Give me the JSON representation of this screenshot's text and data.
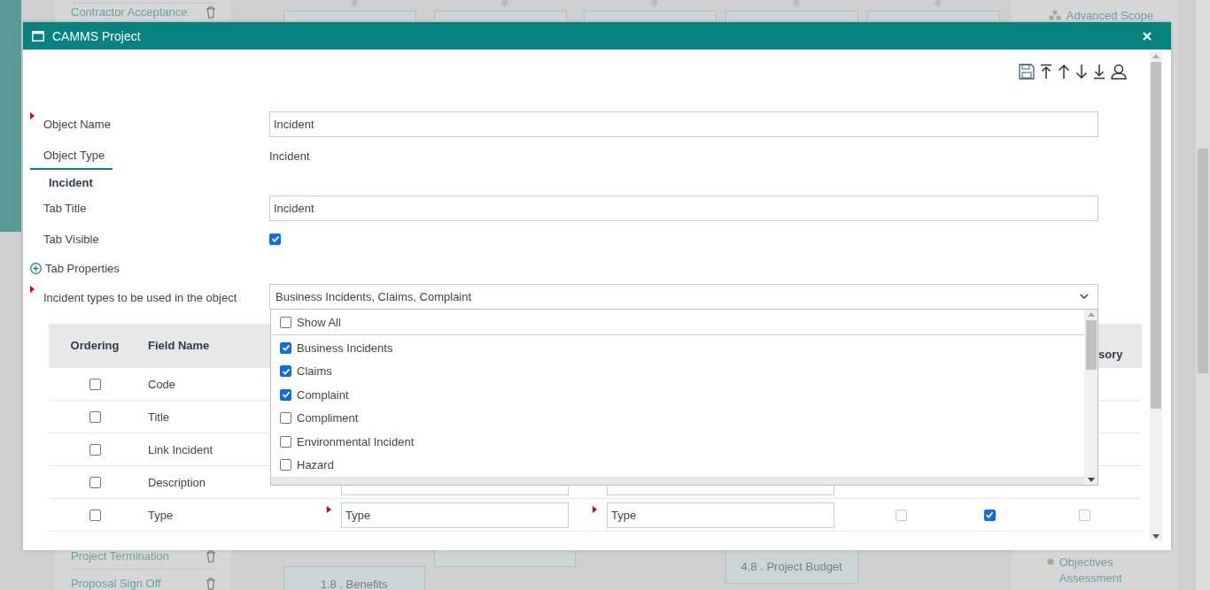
{
  "background_page": {
    "left_panel": {
      "top_items": [
        {
          "label": "Contractor Acceptance"
        }
      ],
      "bottom_items": [
        {
          "label": "Project Termination"
        },
        {
          "label": "Proposal Sign Off"
        }
      ]
    },
    "flow_boxes": [
      {
        "label": "1.8 . Benefits",
        "kind": "bottom-left"
      },
      {
        "label": "4.8 . Project Budget",
        "kind": "bottom-right"
      }
    ],
    "right_panel": {
      "top_items": [
        {
          "label": "Advanced Scope"
        }
      ],
      "bottom_items": [
        {
          "label": "Objectives Assessment"
        }
      ]
    }
  },
  "dialog": {
    "title": "CAMMS Project",
    "form": {
      "object_name": {
        "label": "Object Name",
        "required": true,
        "value": "Incident"
      },
      "object_type": {
        "label": "Object Type",
        "value": "Incident"
      },
      "section_title": "Incident",
      "tab_title": {
        "label": "Tab Title",
        "value": "Incident"
      },
      "tab_visible": {
        "label": "Tab Visible",
        "checked": true
      },
      "tab_properties": {
        "label": "Tab Properties",
        "expanded": false
      },
      "incident_types": {
        "label": "Incident types to be used in the object",
        "required": true,
        "value": "Business Incidents, Claims, Complaint",
        "options": [
          {
            "label": "Show All",
            "checked": false
          },
          {
            "label": "Business Incidents",
            "checked": true
          },
          {
            "label": "Claims",
            "checked": true
          },
          {
            "label": "Complaint",
            "checked": true
          },
          {
            "label": "Compliment",
            "checked": false
          },
          {
            "label": "Environmental Incident",
            "checked": false
          },
          {
            "label": "Hazard",
            "checked": false
          }
        ]
      }
    },
    "table": {
      "columns": [
        {
          "label": "Ordering"
        },
        {
          "label": "Field Name"
        },
        {
          "label": "sory"
        }
      ],
      "rows": [
        {
          "field_name": "Code",
          "ordering": false,
          "kind": "plain"
        },
        {
          "field_name": "Title",
          "ordering": false,
          "kind": "plain"
        },
        {
          "field_name": "Link Incident",
          "ordering": false,
          "kind": "plain"
        },
        {
          "field_name": "Description",
          "ordering": false,
          "kind": "inputs"
        },
        {
          "field_name": "Type",
          "ordering": false,
          "kind": "full",
          "required": true,
          "input_1": "Type",
          "input_2": "Type",
          "checks": [
            {
              "checked": false,
              "disabled": true
            },
            {
              "checked": true,
              "disabled": false
            },
            {
              "checked": false,
              "disabled": true
            }
          ]
        }
      ]
    }
  }
}
